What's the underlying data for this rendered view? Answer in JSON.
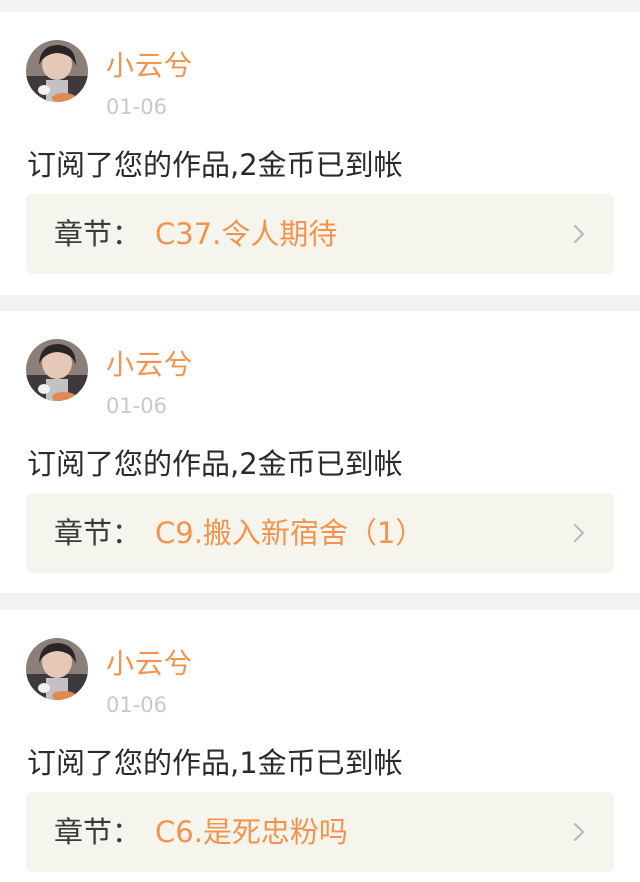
{
  "colors": {
    "accent": "#f3944e",
    "date": "#c8c8c8",
    "chapter_bg": "#f5f5ee",
    "divider": "#f3f2f2"
  },
  "notifications": [
    {
      "username": "小云兮",
      "date": "01-06",
      "message": "订阅了您的作品,2金币已到帐",
      "chapter_prefix": "章节：",
      "chapter_title": "C37.令人期待",
      "avatar_icon": "avatar-icon",
      "link_icon": "chevron-right-icon"
    },
    {
      "username": "小云兮",
      "date": "01-06",
      "message": "订阅了您的作品,2金币已到帐",
      "chapter_prefix": "章节：",
      "chapter_title": "C9.搬入新宿舍（1）",
      "avatar_icon": "avatar-icon",
      "link_icon": "chevron-right-icon"
    },
    {
      "username": "小云兮",
      "date": "01-06",
      "message": "订阅了您的作品,1金币已到帐",
      "chapter_prefix": "章节：",
      "chapter_title": "C6.是死忠粉吗",
      "avatar_icon": "avatar-icon",
      "link_icon": "chevron-right-icon"
    }
  ]
}
